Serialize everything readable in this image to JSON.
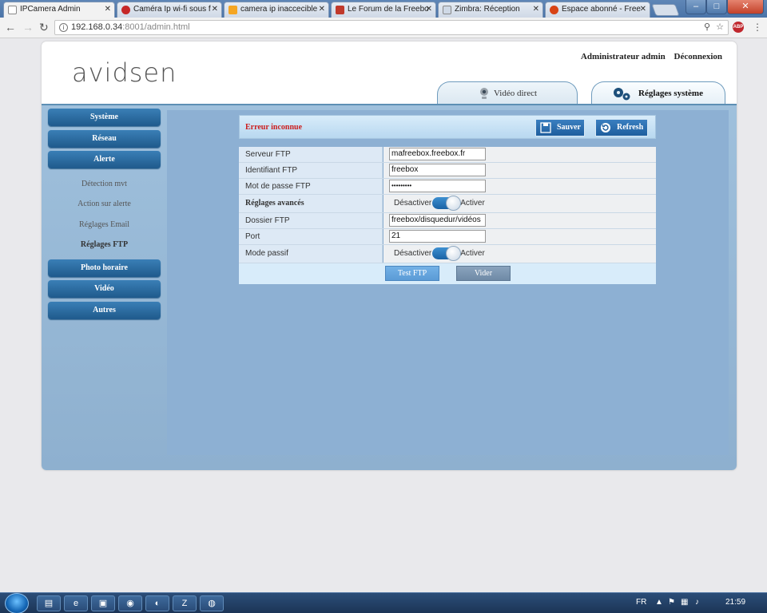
{
  "browser": {
    "tabs": [
      {
        "label": "IPCamera Admin",
        "favicon_color": "#ffffff",
        "active": true
      },
      {
        "label": "Caméra Ip wi-fi sous f",
        "favicon_color": "#c62828",
        "active": false
      },
      {
        "label": "camera ip inaccecible",
        "favicon_color": "#f5a623",
        "active": false
      },
      {
        "label": "Le Forum de la Freebo",
        "favicon_color": "#c0392b",
        "active": false
      },
      {
        "label": "Zimbra: Réception",
        "favicon_color": "#cfd9e6",
        "active": false
      },
      {
        "label": "Espace abonné - Free",
        "favicon_color": "#d84315",
        "active": false
      }
    ],
    "url_host": "192.168.0.34",
    "url_rest": ":8001/admin.html"
  },
  "page": {
    "logo": "avidsen",
    "admin_label": "Administrateur admin",
    "logout_label": "Déconnexion",
    "tab_video": "Vidéo direct",
    "tab_system": "Réglages système"
  },
  "sidebar": {
    "main_top": [
      {
        "label": "Système"
      },
      {
        "label": "Réseau"
      },
      {
        "label": "Alerte"
      }
    ],
    "sub": [
      {
        "label": "Détection mvt"
      },
      {
        "label": "Action sur alerte"
      },
      {
        "label": "Réglages Email"
      },
      {
        "label": "Réglages FTP"
      }
    ],
    "main_bottom": [
      {
        "label": "Photo horaire"
      },
      {
        "label": "Vidéo"
      },
      {
        "label": "Autres"
      }
    ]
  },
  "header": {
    "error": "Erreur inconnue",
    "save_label": "Sauver",
    "refresh_label": "Refresh"
  },
  "form": {
    "server_label": "Serveur FTP",
    "server_value": "mafreebox.freebox.fr",
    "user_label": "Identifiant FTP",
    "user_value": "freebox",
    "pass_label": "Mot de passe FTP",
    "pass_value": "•••••••••",
    "advanced_label": "Réglages avancés",
    "off_label": "Désactiver",
    "on_label": "Activer",
    "folder_label": "Dossier FTP",
    "folder_value": "freebox/disquedur/vidéos",
    "port_label": "Port",
    "port_value": "21",
    "passive_label": "Mode passif",
    "test_label": "Test FTP",
    "clear_label": "Vider"
  },
  "taskbar": {
    "lang": "FR",
    "time": "21:59"
  }
}
